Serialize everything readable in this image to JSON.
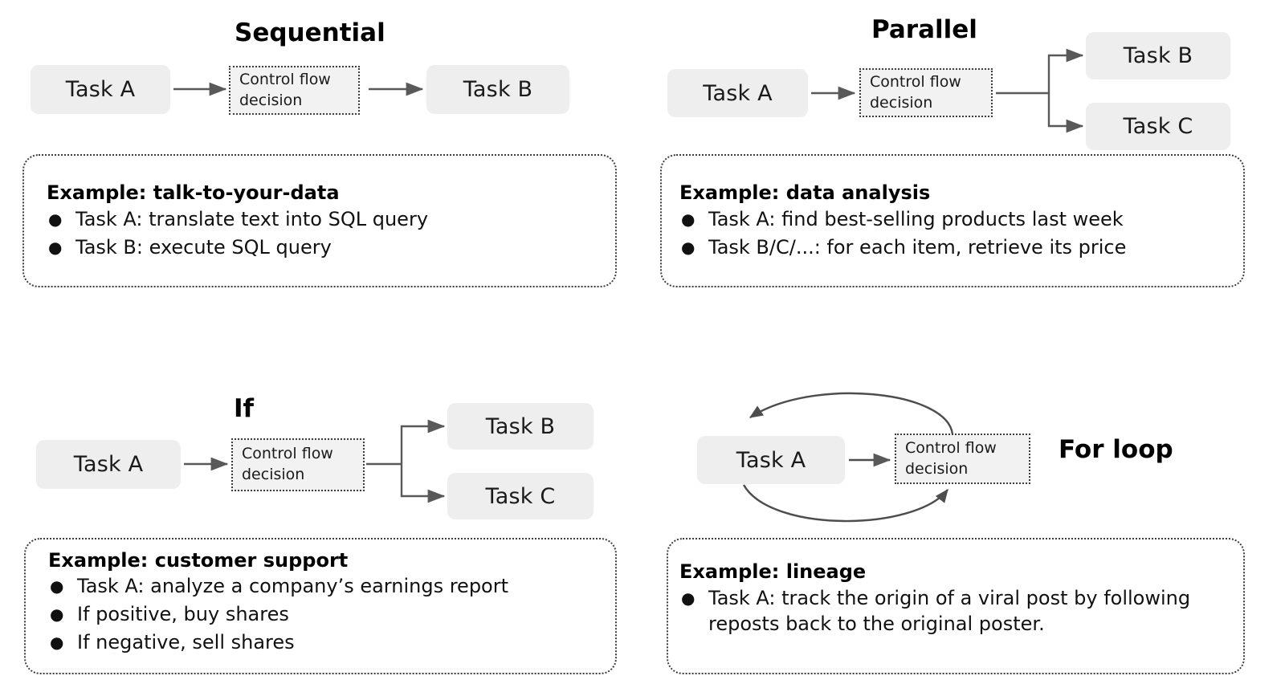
{
  "diagram": {
    "title_icons": [
      "arrow-right-icon",
      "loop-arrow-icon"
    ],
    "accent_box_color": "#eeeeee",
    "line_color": "#595959",
    "border_color": "#3d3d3d"
  },
  "patterns": [
    {
      "id": "sequential",
      "title": "Sequential",
      "nodes": {
        "task_a": "Task A",
        "control_flow_line1": "Control flow",
        "control_flow_line2": "decision",
        "task_b": "Task B"
      },
      "example": {
        "heading": "Example: talk-to-your-data",
        "bullets": [
          "Task A: translate text into SQL query",
          "Task B: execute SQL query"
        ]
      }
    },
    {
      "id": "parallel",
      "title": "Parallel",
      "nodes": {
        "task_a": "Task A",
        "control_flow_line1": "Control flow",
        "control_flow_line2": "decision",
        "task_b": "Task B",
        "task_c": "Task C"
      },
      "example": {
        "heading": "Example: data analysis",
        "bullets": [
          "Task A:  find best-selling products last week",
          "Task B/C/...: for each item, retrieve its price"
        ]
      }
    },
    {
      "id": "if",
      "title": "If",
      "nodes": {
        "task_a": "Task A",
        "control_flow_line1": "Control flow",
        "control_flow_line2": "decision",
        "task_b": "Task B",
        "task_c": "Task C"
      },
      "example": {
        "heading": "Example: customer support",
        "bullets": [
          "Task A: analyze a company’s earnings report",
          "If positive, buy shares",
          "If negative, sell shares"
        ]
      }
    },
    {
      "id": "for-loop",
      "title": "For loop",
      "nodes": {
        "task_a": "Task A",
        "control_flow_line1": "Control flow",
        "control_flow_line2": "decision"
      },
      "example": {
        "heading": "Example: lineage",
        "bullets": [
          "Task A:  track the origin of a viral post by following reposts back to the original poster."
        ]
      }
    }
  ],
  "bullet_glyph": "●"
}
